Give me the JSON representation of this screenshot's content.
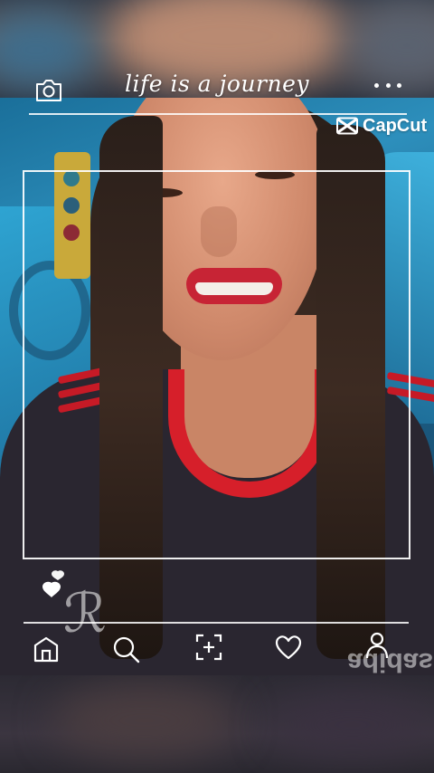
{
  "overlay": {
    "title": "life is a journey",
    "watermark": "CapCut"
  },
  "icons": {
    "top_left": "camera-icon",
    "top_right": "more-dots-icon",
    "like": "heart-filled-icon",
    "nav": [
      "home-icon",
      "search-icon",
      "add-post-icon",
      "heart-outline-icon",
      "profile-icon"
    ]
  },
  "colors": {
    "overlay": "#ffffff",
    "shirt_accent": "#d61f2a",
    "seat_blue": "#2d8fbc"
  }
}
